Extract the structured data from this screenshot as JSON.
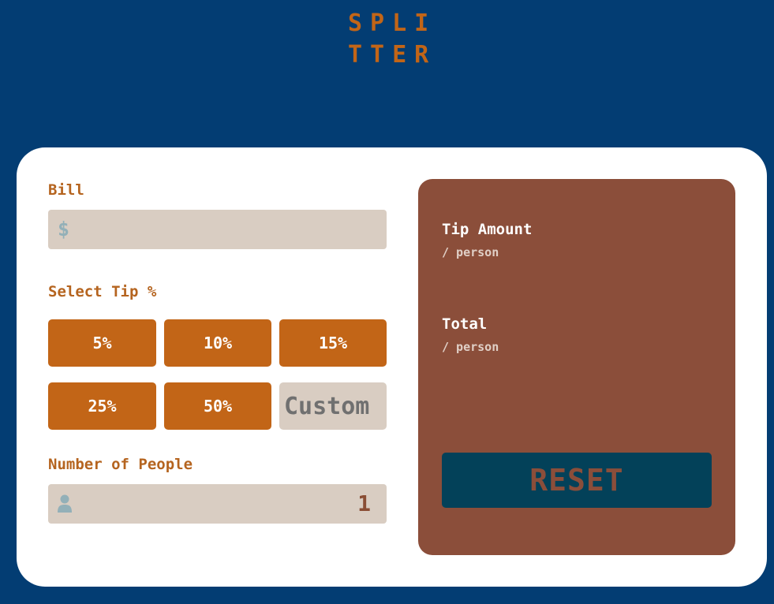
{
  "logo": {
    "line1": "SPLI",
    "line2": "TTER"
  },
  "bill": {
    "label": "Bill",
    "currency_symbol": "$",
    "value": ""
  },
  "tip": {
    "label": "Select Tip %",
    "options": [
      "5%",
      "10%",
      "15%",
      "25%",
      "50%"
    ],
    "custom_placeholder": "Custom"
  },
  "people": {
    "label": "Number of People",
    "icon": "person-icon",
    "value": "1"
  },
  "results": {
    "tip_amount_label": "Tip Amount",
    "tip_amount_sub": "/ person",
    "total_label": "Total",
    "total_sub": "/ person",
    "reset_label": "RESET"
  },
  "colors": {
    "background": "#033d73",
    "accent": "#c26517",
    "panel": "#8b4e3a",
    "input_bg": "#d9cdc2",
    "reset_bg": "#034159"
  }
}
